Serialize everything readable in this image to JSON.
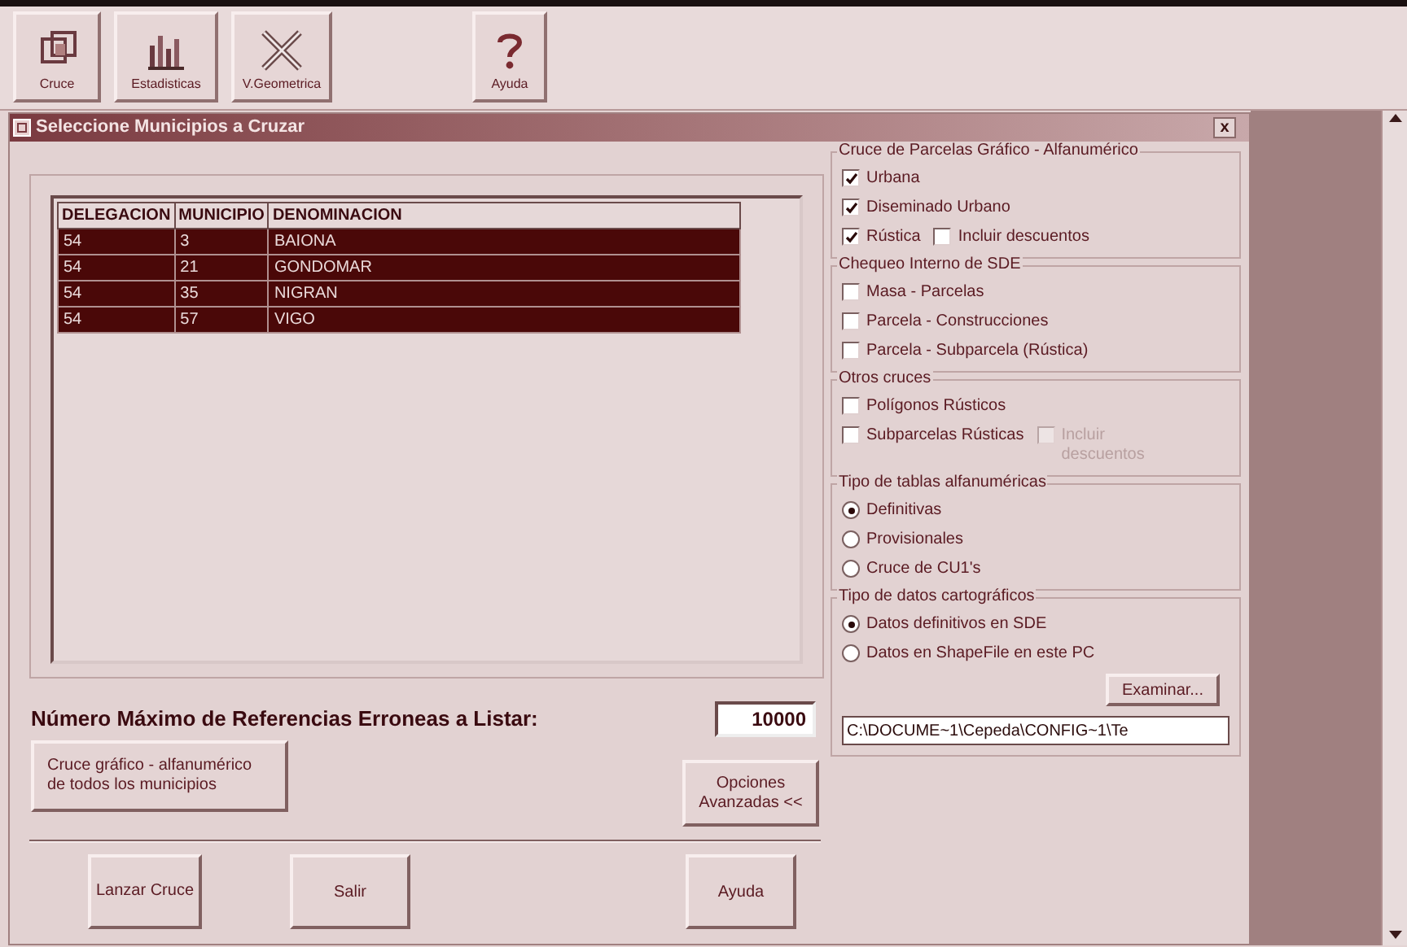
{
  "toolbar": [
    {
      "label": "Cruce"
    },
    {
      "label": "Estadisticas"
    },
    {
      "label": "V.Geometrica"
    },
    {
      "label": "Ayuda"
    }
  ],
  "dialog": {
    "title": "Seleccione Municipios a Cruzar",
    "close": "x"
  },
  "table": {
    "columns": [
      "DELEGACION",
      "MUNICIPIO",
      "DENOMINACION"
    ],
    "rows": [
      {
        "cells": [
          "54",
          "3",
          "BAIONA"
        ],
        "selected": true
      },
      {
        "cells": [
          "54",
          "21",
          "GONDOMAR"
        ],
        "selected": true
      },
      {
        "cells": [
          "54",
          "35",
          "NIGRAN"
        ],
        "selected": true
      },
      {
        "cells": [
          "54",
          "57",
          "VIGO"
        ],
        "selected": true
      }
    ]
  },
  "max_refs": {
    "label": "Número Máximo de Referencias Erroneas a Listar:",
    "value": "10000"
  },
  "buttons": {
    "cruce_todos": "Cruce gráfico - alfanumérico de todos los municipios",
    "opciones": "Opciones Avanzadas <<",
    "lanzar": "Lanzar Cruce",
    "salir": "Salir",
    "ayuda": "Ayuda"
  },
  "groups": [
    {
      "title": "Cruce de Parcelas Gráfico - Alfanumérico",
      "rows": [
        [
          {
            "kind": "checkbox",
            "label": "Urbana",
            "checked": true,
            "disabled": false
          }
        ],
        [
          {
            "kind": "checkbox",
            "label": "Diseminado Urbano",
            "checked": true,
            "disabled": false
          }
        ],
        [
          {
            "kind": "checkbox",
            "label": "Rústica",
            "checked": true,
            "disabled": false
          },
          {
            "kind": "checkbox",
            "label": "Incluir descuentos",
            "checked": false,
            "disabled": false
          }
        ]
      ]
    },
    {
      "title": "Chequeo Interno de SDE",
      "rows": [
        [
          {
            "kind": "checkbox",
            "label": "Masa - Parcelas",
            "checked": false,
            "disabled": false
          }
        ],
        [
          {
            "kind": "checkbox",
            "label": "Parcela - Construcciones",
            "checked": false,
            "disabled": false
          }
        ],
        [
          {
            "kind": "checkbox",
            "label": "Parcela - Subparcela (Rústica)",
            "checked": false,
            "disabled": false
          }
        ]
      ]
    },
    {
      "title": "Otros cruces",
      "rows": [
        [
          {
            "kind": "checkbox",
            "label": "Polígonos Rústicos",
            "checked": false,
            "disabled": false
          }
        ],
        [
          {
            "kind": "checkbox",
            "label": "Subparcelas Rústicas",
            "checked": false,
            "disabled": false
          },
          {
            "kind": "checkbox",
            "label": "Incluir descuentos",
            "checked": false,
            "disabled": true
          }
        ]
      ]
    },
    {
      "title": "Tipo de tablas alfanuméricas",
      "rows": [
        [
          {
            "kind": "radio",
            "label": "Definitivas",
            "selected": true,
            "disabled": false
          }
        ],
        [
          {
            "kind": "radio",
            "label": "Provisionales",
            "selected": false,
            "disabled": false
          }
        ],
        [
          {
            "kind": "radio",
            "label": "Cruce de CU1's",
            "selected": false,
            "disabled": false
          }
        ]
      ]
    },
    {
      "title": "Tipo de datos cartográficos",
      "rows": [
        [
          {
            "kind": "radio",
            "label": "Datos definitivos en SDE",
            "selected": true,
            "disabled": false
          }
        ],
        [
          {
            "kind": "radio",
            "label": "Datos en ShapeFile en este PC",
            "selected": false,
            "disabled": false
          }
        ]
      ],
      "browse": "Examinar...",
      "path": "C:\\DOCUME~1\\Cepeda\\CONFIG~1\\Te"
    }
  ]
}
